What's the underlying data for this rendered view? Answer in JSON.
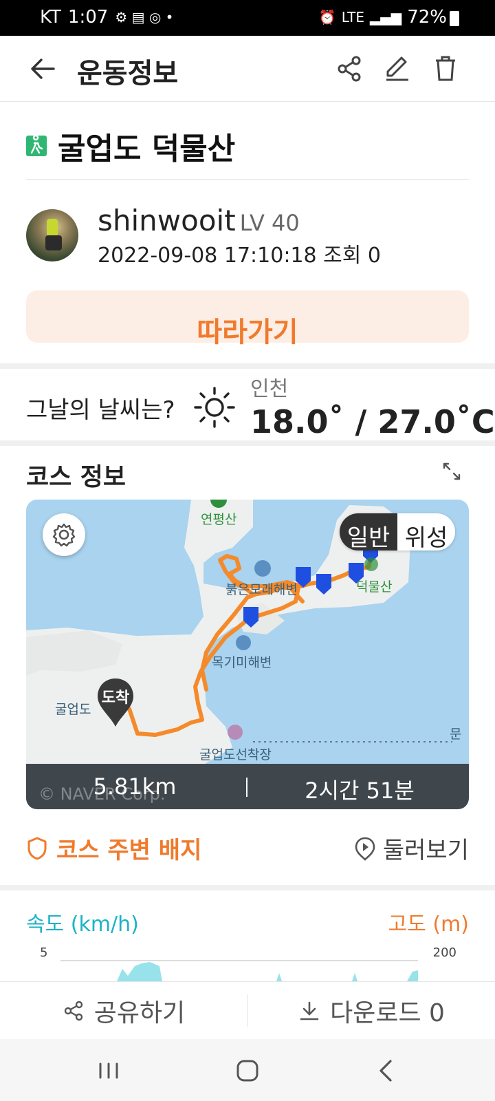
{
  "status_bar": {
    "carrier": "KT",
    "time": "1:07",
    "network": "LTE",
    "battery": "72%"
  },
  "app_bar": {
    "title": "운동정보"
  },
  "course": {
    "name": "굴업도 덕물산"
  },
  "user": {
    "name": "shinwooit",
    "level": "LV 40",
    "meta": "2022-09-08 17:10:18 조회 0"
  },
  "follow_label": "따라가기",
  "weather": {
    "label": "그날의 날씨는?",
    "city": "인천",
    "temp": "18.0˚ / 27.0˚C"
  },
  "course_info": {
    "heading": "코스 정보"
  },
  "map": {
    "toggle_on": "일반",
    "toggle_off": "위성",
    "labels": {
      "yeonpyeongsan": "연평산",
      "beach1": "붉은모래해변",
      "deokmulsan": "덕물산",
      "beach2": "목기미해변",
      "island": "굴업도",
      "port": "굴업도선착장",
      "edge": "문"
    },
    "arrive": "도착",
    "distance": "5.81km",
    "duration": "2시간 51분",
    "watermark": "© NAVER Corp."
  },
  "badge_link": "코스 주변 배지",
  "tour_link": "둘러보기",
  "chart_data": {
    "type": "area",
    "left_axis_label": "속도 (km/h)",
    "right_axis_label": "고도 (m)",
    "left_tick": "5",
    "right_tick": "200",
    "colors": {
      "speed": "#1ab3c6",
      "altitude": "#f07a2c"
    }
  },
  "bottom": {
    "share": "공유하기",
    "download": "다운로드 0"
  },
  "colors": {
    "accent": "#f07a2c",
    "speed": "#1ab3c6",
    "map_water": "#a9d3ef",
    "route": "#f58a2a",
    "pin": "#1f4fe0"
  }
}
